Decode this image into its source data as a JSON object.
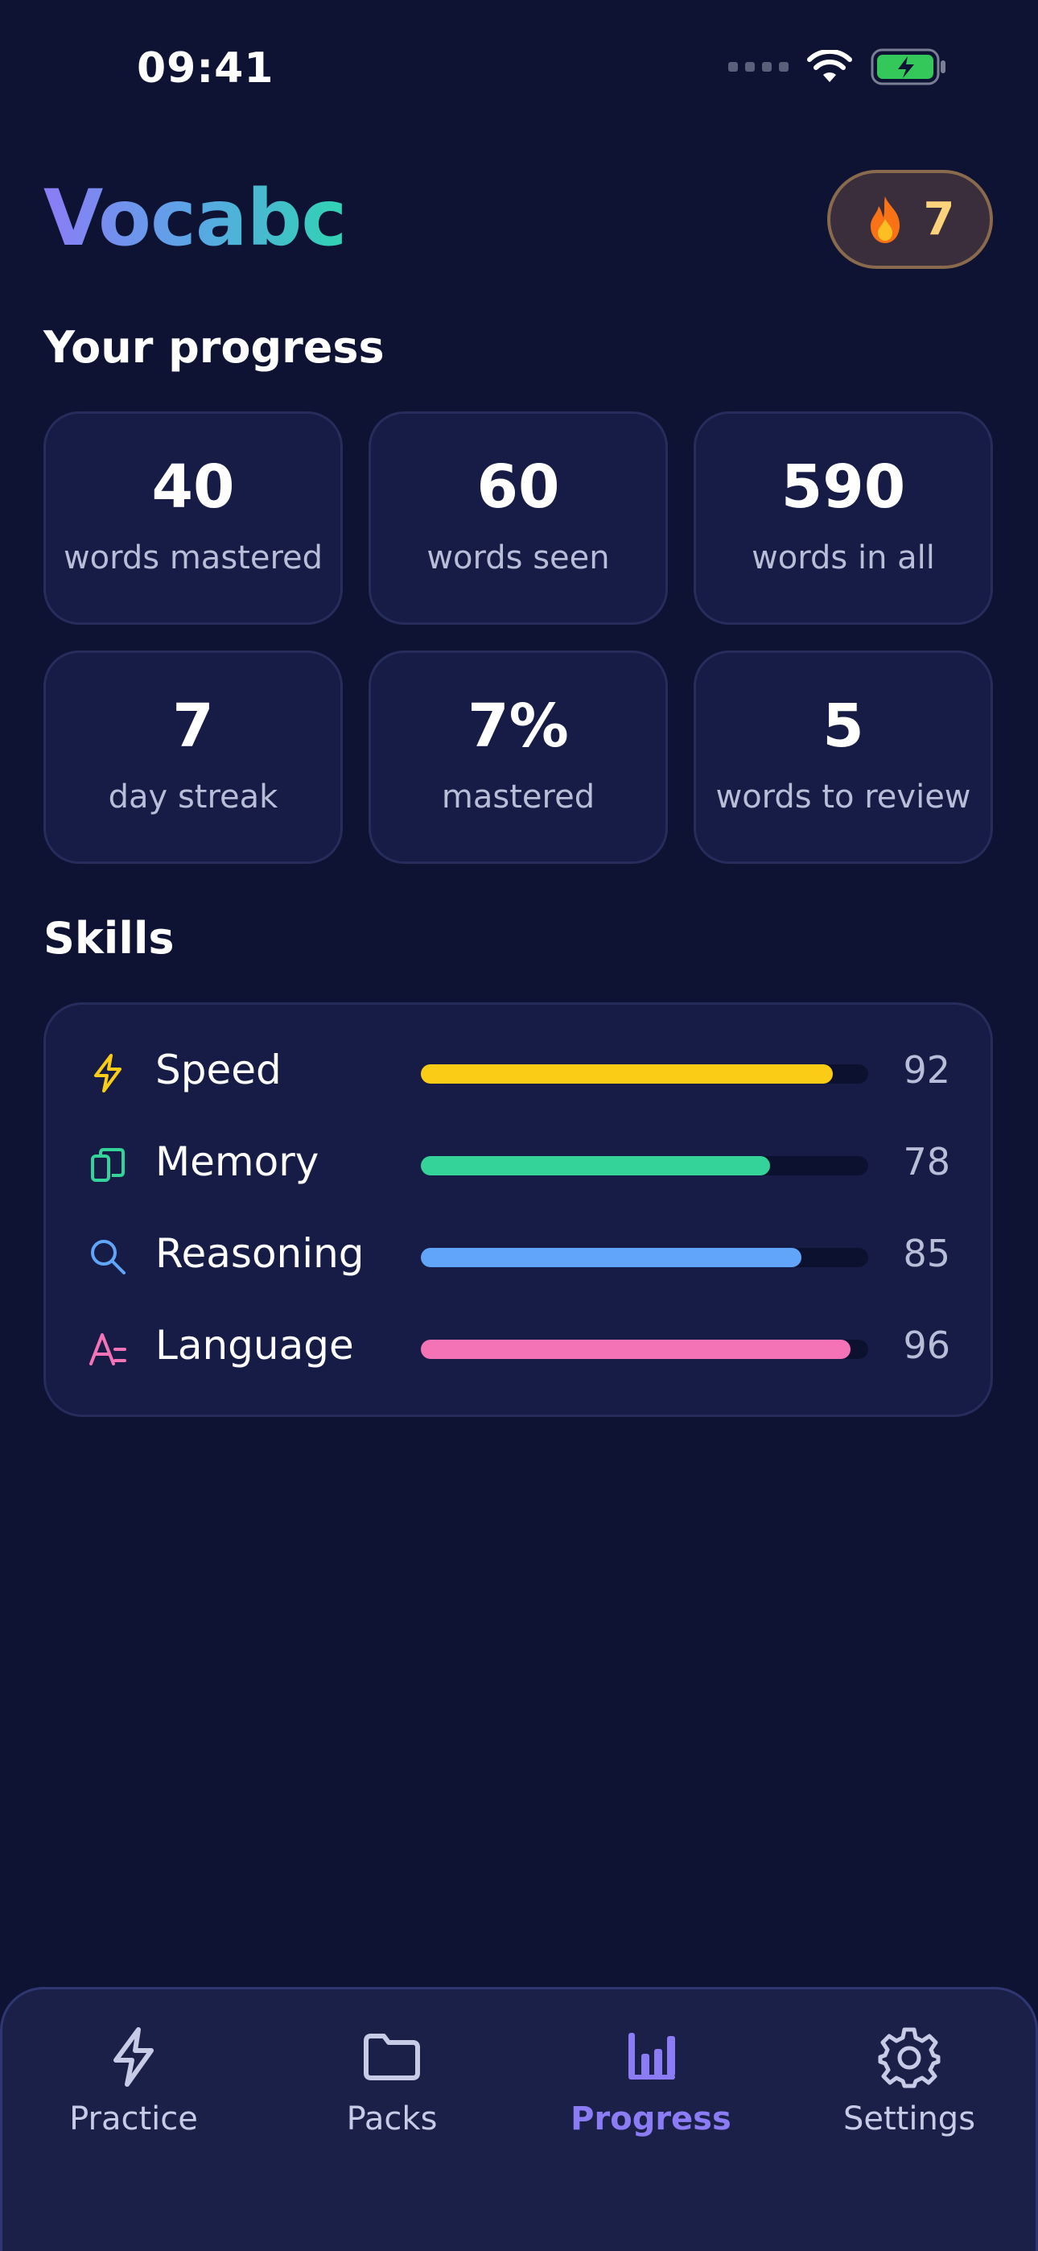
{
  "status_bar": {
    "time": "09:41"
  },
  "header": {
    "app_name": "Vocabc",
    "streak_count": "7"
  },
  "progress": {
    "title": "Your progress",
    "stats": [
      {
        "value": "40",
        "label": "words mastered"
      },
      {
        "value": "60",
        "label": "words seen"
      },
      {
        "value": "590",
        "label": "words in all"
      },
      {
        "value": "7",
        "label": "day streak"
      },
      {
        "value": "7%",
        "label": "mastered"
      },
      {
        "value": "5",
        "label": "words to review"
      }
    ]
  },
  "skills": {
    "title": "Skills",
    "items": [
      {
        "name": "Speed",
        "score": "92",
        "level": 0.92,
        "color": "#facc15",
        "icon": "lightning-icon"
      },
      {
        "name": "Memory",
        "score": "78",
        "level": 0.78,
        "color": "#34d399",
        "icon": "cards-icon"
      },
      {
        "name": "Reasoning",
        "score": "85",
        "level": 0.85,
        "color": "#60a5fa",
        "icon": "search-icon"
      },
      {
        "name": "Language",
        "score": "96",
        "level": 0.96,
        "color": "#f472b6",
        "icon": "language-icon"
      }
    ]
  },
  "nav": {
    "items": [
      {
        "label": "Practice",
        "icon": "lightning-icon"
      },
      {
        "label": "Packs",
        "icon": "folder-icon"
      },
      {
        "label": "Progress",
        "icon": "bar-chart-icon",
        "active": true
      },
      {
        "label": "Settings",
        "icon": "gear-icon"
      }
    ]
  },
  "colors": {
    "background": "#0f1333",
    "card": "#161c45",
    "accent": "#8b7cf6",
    "streak": "#fcd37a"
  }
}
